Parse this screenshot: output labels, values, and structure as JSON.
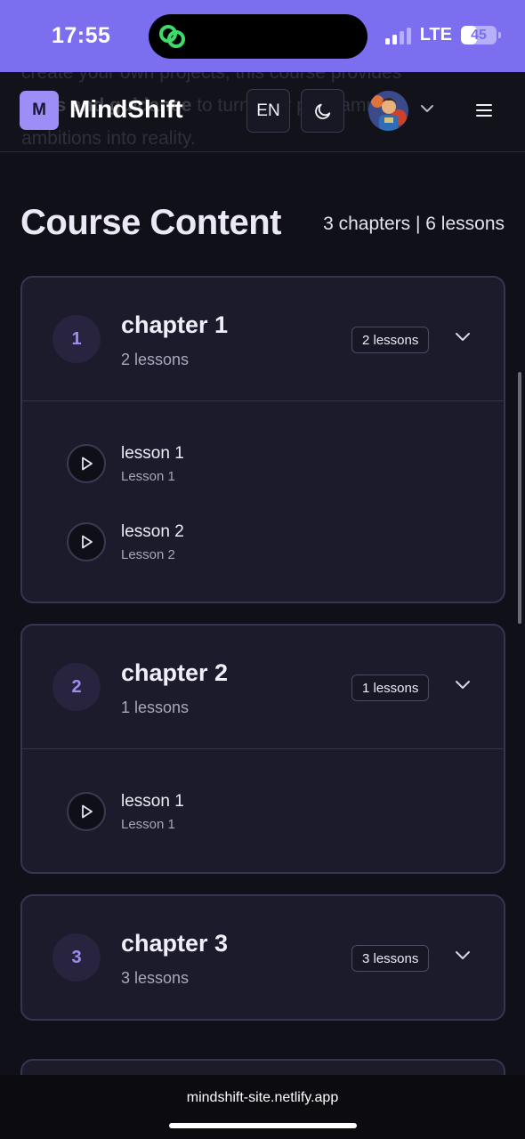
{
  "status_bar": {
    "time": "17:55",
    "network": "LTE",
    "battery": "45",
    "battery_level": 0.45,
    "signal_bars_active": 2,
    "signal_bars_total": 4,
    "island_icon": "link-icon",
    "accent_color": "#7b6ff0"
  },
  "header": {
    "ghost_text_line1": "create your own projects, this course provides",
    "ghost_text_line2_bold": "tools and guidance",
    "ghost_text_line2_rest": " to turn your programming",
    "ghost_text_line3": "ambitions into reality.",
    "logo_letter": "M",
    "logo_name": "MindShift",
    "language_label": "EN",
    "theme_icon": "moon-icon",
    "avatar_icon": "user-avatar",
    "menu_icon": "hamburger-icon"
  },
  "course": {
    "title": "Course Content",
    "summary": "3 chapters | 6 lessons",
    "chapters": [
      {
        "number": "1",
        "title": "chapter 1",
        "subtitle": "2 lessons",
        "badge": "2 lessons",
        "lessons": [
          {
            "title": "lesson 1",
            "subtitle": "Lesson 1"
          },
          {
            "title": "lesson 2",
            "subtitle": "Lesson 2"
          }
        ]
      },
      {
        "number": "2",
        "title": "chapter 2",
        "subtitle": "1 lessons",
        "badge": "1 lessons",
        "lessons": [
          {
            "title": "lesson 1",
            "subtitle": "Lesson 1"
          }
        ]
      },
      {
        "number": "3",
        "title": "chapter 3",
        "subtitle": "3 lessons",
        "badge": "3 lessons",
        "lessons": []
      }
    ]
  },
  "browser": {
    "url": "mindshift-site.netlify.app"
  },
  "colors": {
    "background": "#101018",
    "card": "#1b1b2c",
    "accent_purple": "#9d8df6"
  }
}
